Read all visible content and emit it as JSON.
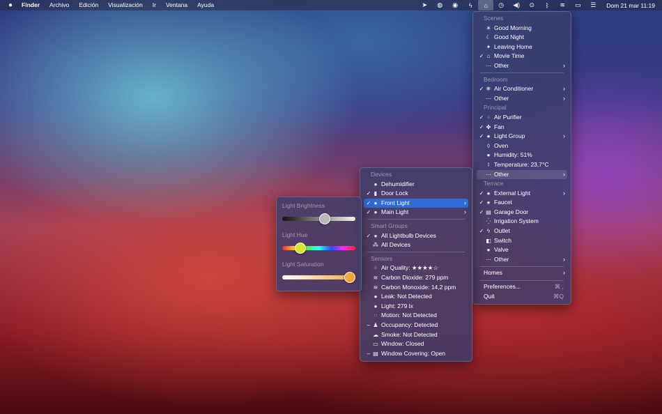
{
  "menubar": {
    "app": "Finder",
    "items": [
      "Archivo",
      "Edición",
      "Visualización",
      "Ir",
      "Ventana",
      "Ayuda"
    ],
    "status_icons": [
      "location-icon",
      "focus-icon",
      "vpn-icon",
      "power-icon",
      "homebridge-icon",
      "time-machine-icon",
      "volume-icon",
      "record-icon",
      "bluetooth-icon",
      "wifi-icon",
      "battery-icon",
      "control-center-icon"
    ],
    "clock": "Dom 21 mar  11:19"
  },
  "main_menu": {
    "scenes_header": "Scenes",
    "scenes": [
      "Good Morning",
      "Good Night",
      "Leaving Home",
      "Movie Time",
      "Other"
    ],
    "bedroom_header": "Bedroom",
    "bedroom": [
      "Air Conditioner",
      "Other"
    ],
    "principal_header": "Principal",
    "principal": [
      "Air Purifier",
      "Fan",
      "Light Group",
      "Oven",
      "Humidity: 51%",
      "Temperature: 23,7°C",
      "Other"
    ],
    "terrace_header": "Terrace",
    "terrace": [
      "External Light",
      "Faucet",
      "Garage Door",
      "Irrigation System",
      "Outlet",
      "Switch",
      "Valve",
      "Other"
    ],
    "homes": "Homes",
    "preferences": "Preferences...",
    "preferences_shortcut": "⌘ ,",
    "quit": "Quit",
    "quit_shortcut": "⌘Q"
  },
  "other_menu": {
    "devices_header": "Devices",
    "devices": [
      "Dehumidifier",
      "Door Lock",
      "Front Light",
      "Main Light"
    ],
    "groups_header": "Smart Groups",
    "groups": [
      "All Lightbulb Devices",
      "All Devices"
    ],
    "sensors_header": "Sensors",
    "sensors": [
      "Air Quality: ★★★★☆",
      "Carbon Dioxide: 279 ppm",
      "Carbon Monoxide: 14,2 ppm",
      "Leak: Not Detected",
      "Light: 279 lx",
      "Motion: Not Detected",
      "Occupancy: Detected",
      "Smoke: Not Detected",
      "Window: Closed",
      "Window Covering: Open"
    ]
  },
  "light_panel": {
    "brightness_label": "Light Brightness",
    "hue_label": "Light Hue",
    "saturation_label": "Light Saturation",
    "brightness_value": 0.6,
    "hue_value": 0.2,
    "saturation_value": 1.0
  },
  "colors": {
    "highlight": "#2f6bd3",
    "hue_knob": "#d6e62a",
    "sat_knob": "#f0a83a"
  }
}
